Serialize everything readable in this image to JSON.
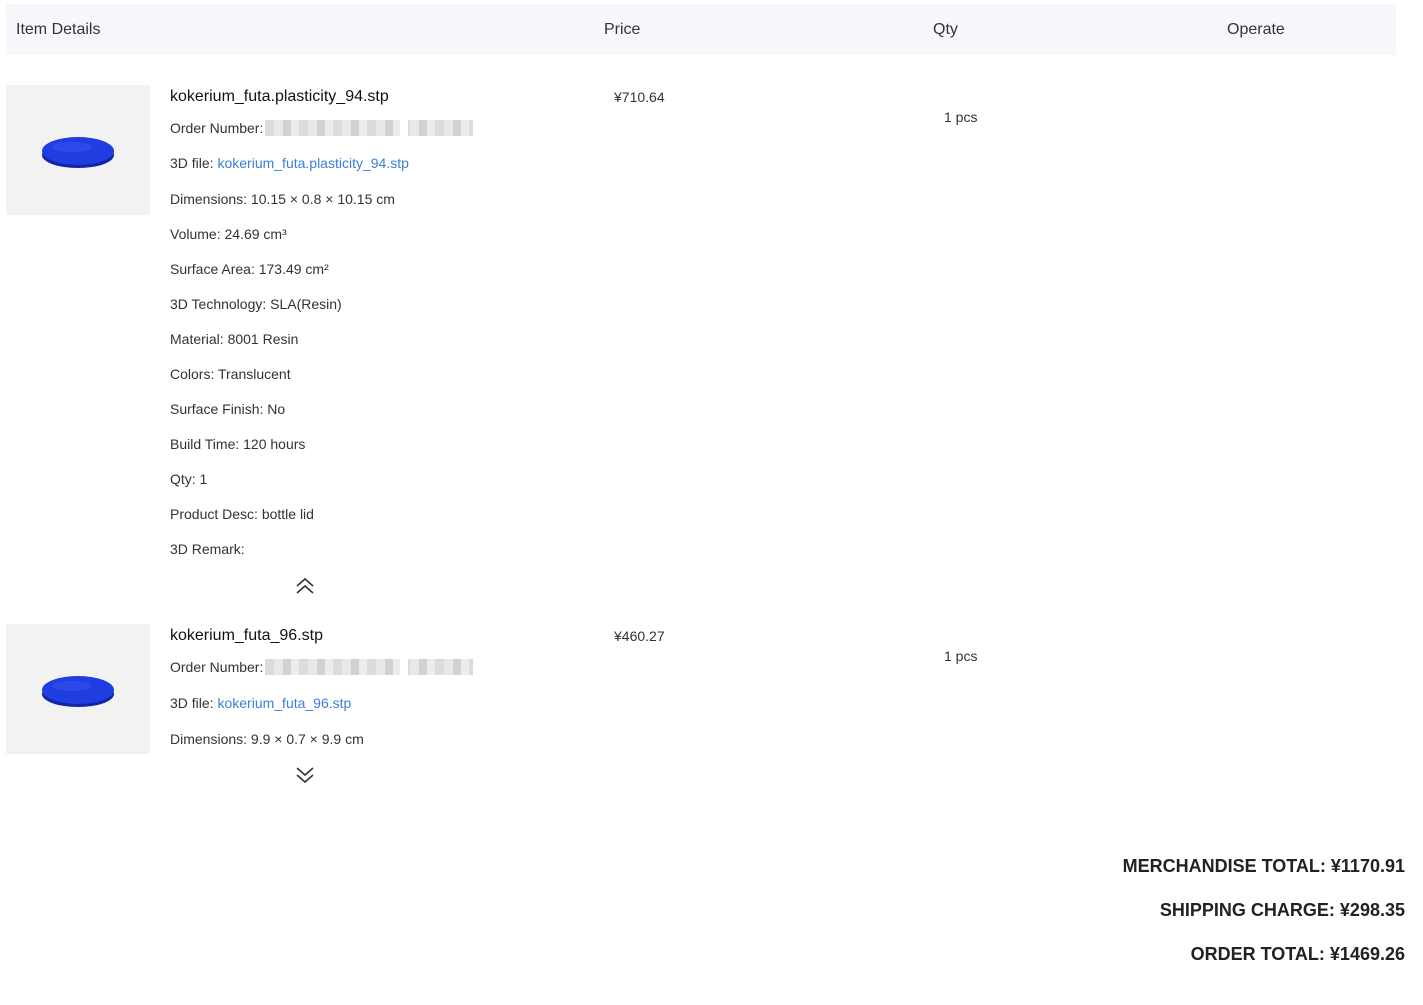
{
  "header": {
    "item_details": "Item Details",
    "price": "Price",
    "qty": "Qty",
    "operate": "Operate"
  },
  "items": [
    {
      "name": "kokerium_futa.plasticity_94.stp",
      "order_number_label": "Order Number:",
      "file_label": "3D file:",
      "file_link": "kokerium_futa.plasticity_94.stp",
      "dimensions": "Dimensions: 10.15 × 0.8 × 10.15 cm",
      "volume": "Volume: 24.69 cm³",
      "surface_area": "Surface Area: 173.49 cm²",
      "technology": "3D Technology: SLA(Resin)",
      "material": "Material: 8001 Resin",
      "colors": "Colors: Translucent",
      "surface_finish": "Surface Finish: No",
      "build_time": "Build Time: 120 hours",
      "qty_line": "Qty: 1",
      "product_desc": "Product Desc: bottle lid",
      "remark": "3D Remark:",
      "price": "¥710.64",
      "qty": "1 pcs",
      "thumb_color": "#1f3de0",
      "toggle_icon": "double-chevron-up-icon"
    },
    {
      "name": "kokerium_futa_96.stp",
      "order_number_label": "Order Number:",
      "file_label": "3D file:",
      "file_link": "kokerium_futa_96.stp",
      "dimensions": "Dimensions: 9.9 × 0.7 × 9.9 cm",
      "price": "¥460.27",
      "qty": "1 pcs",
      "thumb_color": "#1f3de0",
      "toggle_icon": "double-chevron-down-icon"
    }
  ],
  "totals": {
    "merchandise": "MERCHANDISE TOTAL: ¥1170.91",
    "shipping": "SHIPPING CHARGE: ¥298.35",
    "order": "ORDER TOTAL: ¥1469.26"
  }
}
